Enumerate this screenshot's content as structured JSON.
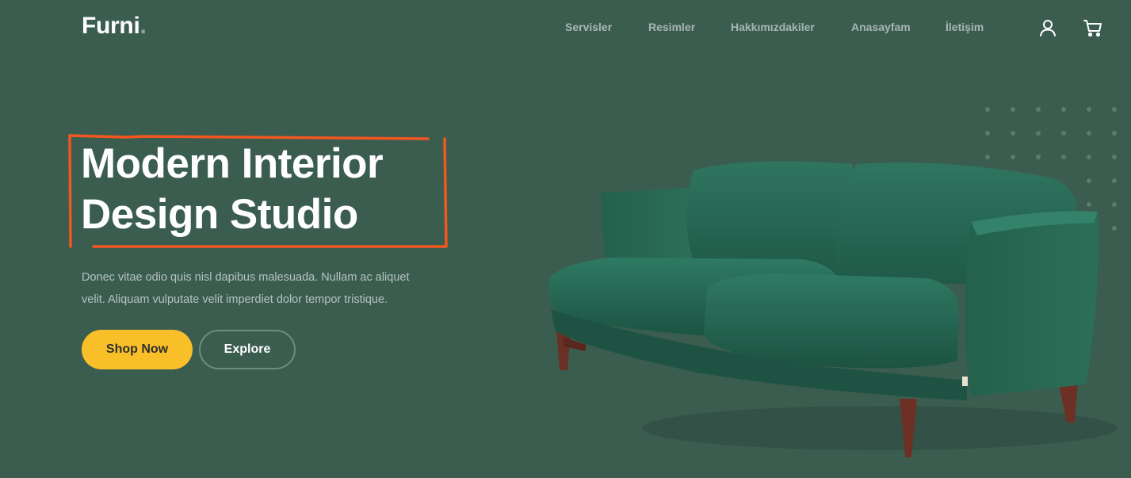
{
  "brand": {
    "name": "Furni",
    "dot": "."
  },
  "nav": {
    "links": [
      "Servisler",
      "Resimler",
      "Hakkımızdakiler",
      "Anasayfam",
      "İletişim"
    ],
    "icons": [
      "user-icon",
      "cart-icon"
    ]
  },
  "hero": {
    "title_line1": "Modern Interior",
    "title_line2": "Design Studio",
    "description": "Donec vitae odio quis nisl dapibus malesuada. Nullam ac aliquet velit. Aliquam vulputate velit imperdiet dolor tempor tristique.",
    "primary_button": "Shop Now",
    "secondary_button": "Explore"
  },
  "colors": {
    "background": "#3b5d50",
    "accent": "#f9bf29",
    "annotation": "#f2571f",
    "sofa": "#2c6a55"
  },
  "hero_image": "green-velvet-sofa"
}
